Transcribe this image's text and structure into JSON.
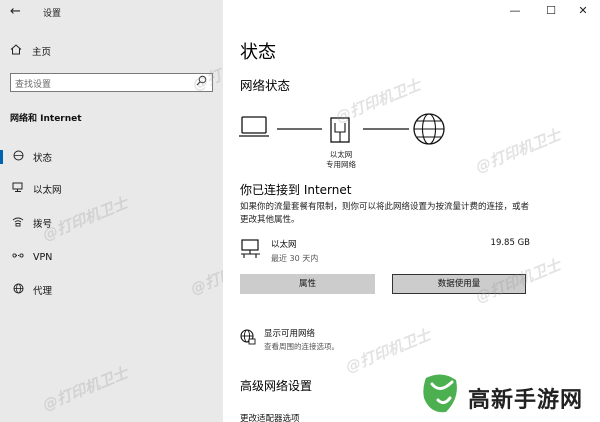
{
  "window": {
    "title": "设置",
    "back_glyph": "←",
    "minimize_glyph": "—",
    "maximize_glyph": "☐",
    "close_glyph": "✕"
  },
  "sidebar": {
    "home_label": "主页",
    "search_placeholder": "查找设置",
    "section_title": "网络和 Internet",
    "items": [
      {
        "label": "状态",
        "icon": "globe-status-icon",
        "selected": true
      },
      {
        "label": "以太网",
        "icon": "ethernet-icon",
        "selected": false
      },
      {
        "label": "拨号",
        "icon": "dialup-icon",
        "selected": false
      },
      {
        "label": "VPN",
        "icon": "vpn-icon",
        "selected": false
      },
      {
        "label": "代理",
        "icon": "globe-icon",
        "selected": false
      }
    ]
  },
  "main": {
    "page_title": "状态",
    "network_status_heading": "网络状态",
    "diagram_label_line1": "以太网",
    "diagram_label_line2": "专用网络",
    "connected_heading": "你已连接到 Internet",
    "connected_desc": "如果你的流量套餐有限制，则你可以将此网络设置为按流量计费的连接，或者更改其他属性。",
    "ethernet": {
      "name": "以太网",
      "sub": "最近 30 天内",
      "size": "19.85 GB"
    },
    "buttons": {
      "properties": "属性",
      "data_usage": "数据使用量"
    },
    "available_networks": {
      "title": "显示可用网络",
      "subtitle": "查看周围的连接选项。"
    },
    "advanced_heading": "高级网络设置",
    "last_item_partial": "更改适配器选项"
  },
  "watermark_text": "@打印机卫士",
  "brand_text": "高新手游网",
  "colors": {
    "sidebar_bg": "#e9e9e9",
    "accent": "#0063b1",
    "button_bg": "#cccccc",
    "brand_green": "#4caf50"
  }
}
